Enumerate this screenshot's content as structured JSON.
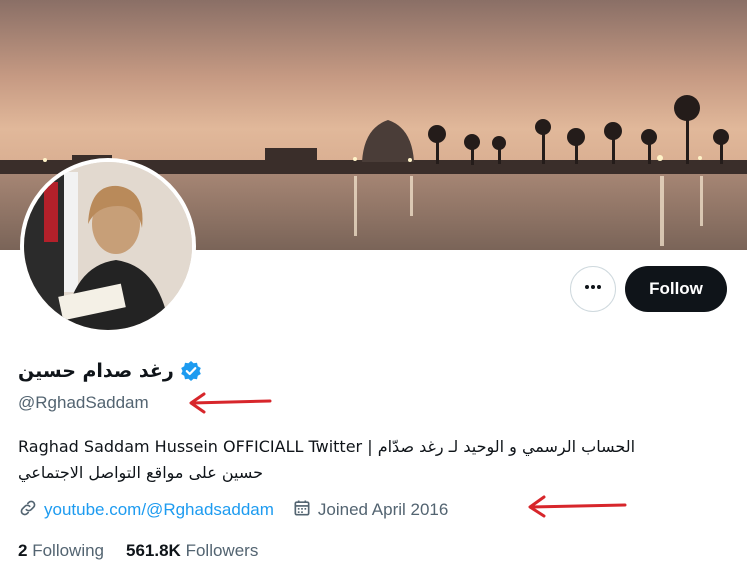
{
  "profile": {
    "display_name": "رغد صدام حسين",
    "handle": "@RghadSaddam",
    "bio_line_1": "Raghad Saddam Hussein OFFICIALL Twitter | الحساب الرسمي و الوحيد لـ رغد صدّام",
    "bio_line_2": "حسين على مواقع التواصل الاجتماعي",
    "website": "youtube.com/@Rghadsaddam",
    "joined": "Joined April 2016"
  },
  "actions": {
    "follow_label": "Follow"
  },
  "stats": {
    "following_count": "2",
    "following_label": "Following",
    "followers_count": "561.8K",
    "followers_label": "Followers"
  },
  "icons": {
    "verified": "verified-badge-icon",
    "more": "more-options-icon",
    "link": "link-icon",
    "calendar": "calendar-icon"
  },
  "colors": {
    "accent": "#1d9bf0",
    "text_primary": "#0f1419",
    "text_secondary": "#536471",
    "follow_bg": "#0f1419",
    "annotation_arrow": "#d7262b"
  }
}
